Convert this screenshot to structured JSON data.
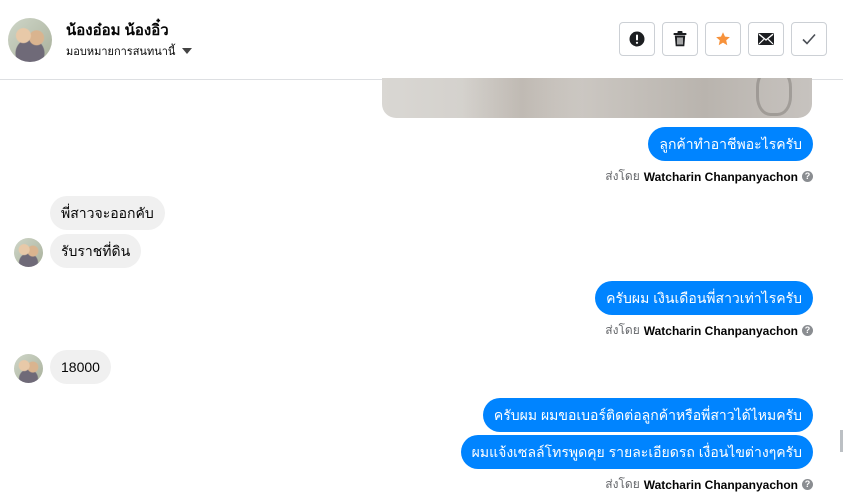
{
  "header": {
    "contact_name": "น้องอ๋อม น้องอิ๋ว",
    "assign_label": "มอบหมายการสนทนานี้"
  },
  "toolbar": {
    "buttons": [
      {
        "icon": "alert-icon",
        "glyph": "!"
      },
      {
        "icon": "trash-icon",
        "glyph": ""
      },
      {
        "icon": "star-icon",
        "glyph": "★",
        "color": "#f7923b"
      },
      {
        "icon": "mail-icon",
        "glyph": "✉"
      },
      {
        "icon": "check-icon",
        "glyph": "✓"
      }
    ]
  },
  "messages": {
    "out_1": "ลูกค้าทำอาชีพอะไรครับ",
    "in_1": "พี่สาวจะออกคับ",
    "in_2": "รับราชที่ดิน",
    "out_2": "ครับผม เงินเดือนพี่สาวเท่าไรครับ",
    "in_3": "18000",
    "out_3": "ครับผม ผมขอเบอร์ติดต่อลูกค้าหรือพี่สาวได้ไหมครับ",
    "out_4": "ผมแจ้งเซลล์โทรพูดคุย รายละเอียดรถ เงื่อนไขต่างๆครับ"
  },
  "sent_by": {
    "prefix": "ส่งโดย",
    "agent": "Watcharin Chanpanyachon",
    "help_glyph": "?"
  },
  "colors": {
    "outgoing_bubble": "#0084ff",
    "incoming_bubble": "#f0f0f0",
    "star": "#f7923b"
  }
}
